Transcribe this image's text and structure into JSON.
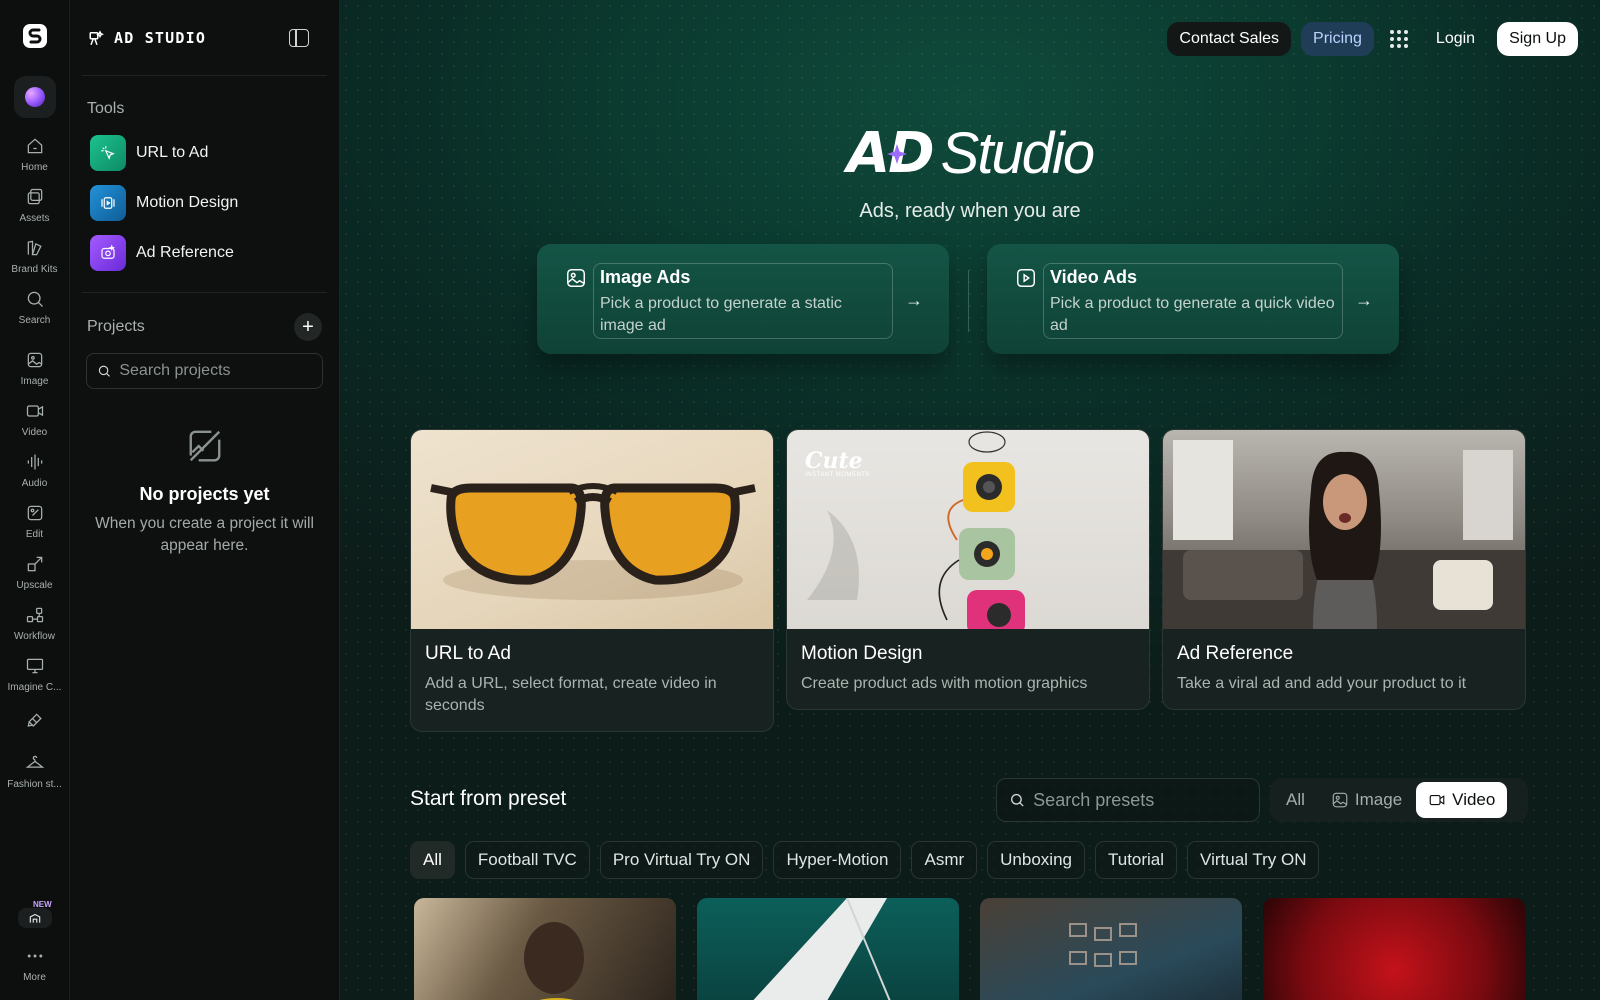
{
  "rail": {
    "items": [
      {
        "label": "Home",
        "icon": "home-icon"
      },
      {
        "label": "Assets",
        "icon": "assets-icon"
      },
      {
        "label": "Brand Kits",
        "icon": "brand-kits-icon"
      },
      {
        "label": "Search",
        "icon": "search-icon"
      },
      {
        "label": "Image",
        "icon": "image-icon"
      },
      {
        "label": "Video",
        "icon": "video-icon"
      },
      {
        "label": "Audio",
        "icon": "audio-icon"
      },
      {
        "label": "Edit",
        "icon": "edit-icon"
      },
      {
        "label": "Upscale",
        "icon": "upscale-icon"
      },
      {
        "label": "Workflow",
        "icon": "workflow-icon"
      },
      {
        "label": "Imagine C...",
        "icon": "monitor-icon"
      },
      {
        "label": "",
        "icon": "stack-icon"
      },
      {
        "label": "Fashion st...",
        "icon": "hanger-icon"
      },
      {
        "label": "More",
        "icon": "more-icon"
      }
    ],
    "new_badge": "NEW"
  },
  "panel": {
    "brand": "AD STUDIO",
    "tools_title": "Tools",
    "tools": [
      {
        "label": "URL to Ad",
        "color": "#12a37a"
      },
      {
        "label": "Motion Design",
        "color": "#1a73b8"
      },
      {
        "label": "Ad Reference",
        "color": "#8a3ff0"
      }
    ],
    "projects_title": "Projects",
    "search_placeholder": "Search projects",
    "empty_title": "No projects yet",
    "empty_desc": "When you create a project it will appear here."
  },
  "topnav": {
    "contact": "Contact Sales",
    "pricing": "Pricing",
    "login": "Login",
    "signup": "Sign Up"
  },
  "hero": {
    "logo_ad": "AD",
    "logo_studio": "Studio",
    "subtitle": "Ads, ready when you are"
  },
  "modes": [
    {
      "title": "Image Ads",
      "desc": "Pick a product to generate a static image ad",
      "arrow": "→"
    },
    {
      "title": "Video Ads",
      "desc": "Pick a product to generate a quick video ad",
      "arrow": "→"
    }
  ],
  "features": [
    {
      "title": "URL to Ad",
      "desc": "Add a URL, select format, create video in seconds"
    },
    {
      "title": "Motion Design",
      "desc": "Create product ads with motion graphics",
      "image_text": "Cute",
      "image_subtext": "INSTANT MOMENTS"
    },
    {
      "title": "Ad Reference",
      "desc": "Take a viral ad and add your product to it"
    }
  ],
  "presets": {
    "title": "Start from preset",
    "search_placeholder": "Search presets",
    "segments": [
      "All",
      "Image",
      "Video"
    ],
    "active_segment": "Video",
    "chips": [
      "All",
      "Football TVC",
      "Pro Virtual Try ON",
      "Hyper-Motion",
      "Asmr",
      "Unboxing",
      "Tutorial",
      "Virtual Try ON"
    ],
    "active_chip": "All"
  },
  "colors": {
    "accent_pricing": "#1f3d56",
    "hero_green": "#0f4a3b"
  }
}
